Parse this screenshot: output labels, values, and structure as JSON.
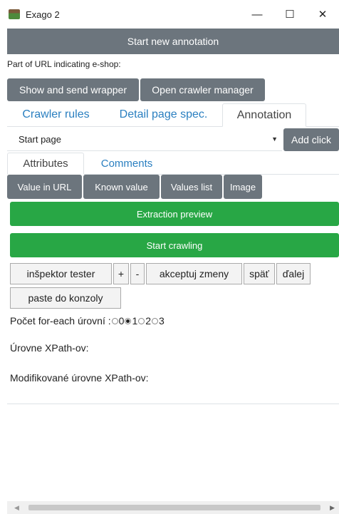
{
  "window": {
    "title": "Exago 2",
    "minimize_glyph": "—",
    "maximize_glyph": "☐",
    "close_glyph": "✕"
  },
  "start_annotation_label": "Start new annotation",
  "url_field": {
    "label": "Part of URL indicating e-shop:",
    "value": "",
    "placeholder": ""
  },
  "toolbar": {
    "show_send_wrapper": "Show and send wrapper",
    "open_crawler_manager": "Open crawler manager"
  },
  "main_tabs": [
    {
      "label": "Crawler rules",
      "active": false
    },
    {
      "label": "Detail page spec.",
      "active": false
    },
    {
      "label": "Annotation",
      "active": true
    }
  ],
  "page_select": {
    "selected": "Start page",
    "caret": "▼"
  },
  "add_click_label": "Add click",
  "sub_tabs": [
    {
      "label": "Attributes",
      "active": true
    },
    {
      "label": "Comments",
      "active": false
    }
  ],
  "attr_buttons": {
    "value_in_url": "Value in URL",
    "known_value": "Known value",
    "values_list": "Values list",
    "image": "Image"
  },
  "extraction_preview_label": "Extraction preview",
  "start_crawling_label": "Start crawling",
  "inspector": {
    "tester": "inšpektor tester",
    "plus": "+",
    "minus": "-",
    "accept": "akceptuj zmeny",
    "back": "späť",
    "next": "ďalej",
    "paste": "paste do konzoly"
  },
  "foreach": {
    "label": "Počet for-each úrovní :",
    "options": [
      "0",
      "1",
      "2",
      "3"
    ],
    "selected": "1"
  },
  "xpath_levels_label": "Úrovne XPath-ov:",
  "modified_xpath_levels_label": "Modifikované úrovne XPath-ov:",
  "colors": {
    "gray_button": "#6c757d",
    "green_button": "#28a745",
    "tab_link": "#2a7fc0",
    "desktop": "#0b2a5c"
  }
}
